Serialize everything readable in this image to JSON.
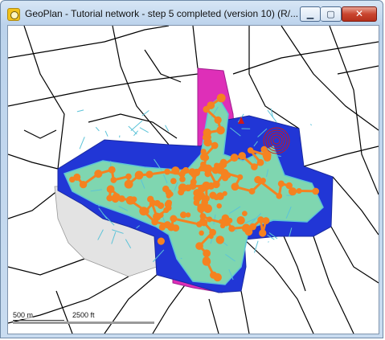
{
  "window": {
    "title": "GeoPlan - Tutorial network - step 5 completed (version 10) (R/...",
    "icon": "geoplan-app-icon",
    "controls": {
      "minimize": "▁",
      "maximize": "▢",
      "close": "✕"
    }
  },
  "map": {
    "colors": {
      "catchment": "#2136d6",
      "subcatchment_fill": "#7fd6b0",
      "subcatchment_edge": "#5cc3d8",
      "nodes": "#f58220",
      "links": "#f58220",
      "developed_zone": "#de2fb8",
      "grey_zone": "#e3e3e3",
      "background_roads": "#000000",
      "rings": "#cc1a1a"
    }
  },
  "scale": {
    "metric_label": "500 m",
    "imperial_label": "2500 ft"
  }
}
